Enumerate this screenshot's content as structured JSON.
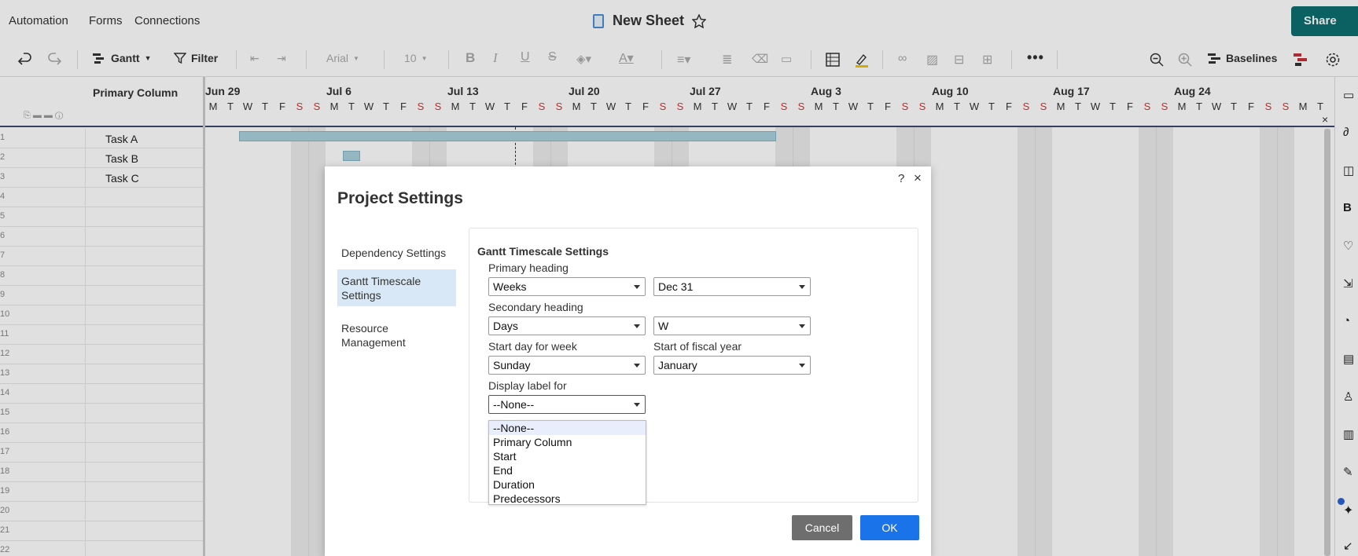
{
  "menu": [
    "Automation",
    "Forms",
    "Connections"
  ],
  "doc": {
    "title": "New Sheet"
  },
  "share_label": "Share",
  "toolbar": {
    "view_label": "Gantt",
    "filter_label": "Filter",
    "font": "Arial",
    "font_size": "10",
    "baselines_label": "Baselines"
  },
  "grid": {
    "primary_column_header": "Primary Column",
    "rows": [
      {
        "num": "1",
        "value": "Task A"
      },
      {
        "num": "2",
        "value": "Task B"
      },
      {
        "num": "3",
        "value": "Task C"
      },
      {
        "num": "4",
        "value": ""
      },
      {
        "num": "5",
        "value": ""
      },
      {
        "num": "6",
        "value": ""
      },
      {
        "num": "7",
        "value": ""
      },
      {
        "num": "8",
        "value": ""
      },
      {
        "num": "9",
        "value": ""
      },
      {
        "num": "10",
        "value": ""
      },
      {
        "num": "11",
        "value": ""
      },
      {
        "num": "12",
        "value": ""
      },
      {
        "num": "13",
        "value": ""
      },
      {
        "num": "14",
        "value": ""
      },
      {
        "num": "15",
        "value": ""
      },
      {
        "num": "16",
        "value": ""
      },
      {
        "num": "17",
        "value": ""
      },
      {
        "num": "18",
        "value": ""
      },
      {
        "num": "19",
        "value": ""
      },
      {
        "num": "20",
        "value": ""
      },
      {
        "num": "21",
        "value": ""
      },
      {
        "num": "22",
        "value": ""
      }
    ]
  },
  "gantt": {
    "weeks": [
      "Jun 29",
      "Jul 6",
      "Jul 13",
      "Jul 20",
      "Jul 27",
      "Aug 3",
      "Aug 10",
      "Aug 17",
      "Aug 24"
    ],
    "days": [
      "S",
      "M",
      "T",
      "W",
      "T",
      "F",
      "S"
    ]
  },
  "dialog": {
    "title": "Project Settings",
    "help": "?",
    "close": "×",
    "sidebar": [
      "Dependency Settings",
      "Gantt Timescale Settings",
      "Resource Management"
    ],
    "panel": {
      "title": "Gantt Timescale Settings",
      "primary_heading_label": "Primary heading",
      "primary_heading_value": "Weeks",
      "primary_heading_format": "Dec 31",
      "secondary_heading_label": "Secondary heading",
      "secondary_heading_value": "Days",
      "secondary_heading_format": "W",
      "start_day_label": "Start day for week",
      "start_day_value": "Sunday",
      "fiscal_year_label": "Start of fiscal year",
      "fiscal_year_value": "January",
      "display_label_label": "Display label for",
      "display_label_value": "--None--",
      "display_label_options": [
        "--None--",
        "Primary Column",
        "Start",
        "End",
        "Duration",
        "Predecessors"
      ]
    },
    "cancel_label": "Cancel",
    "ok_label": "OK"
  }
}
